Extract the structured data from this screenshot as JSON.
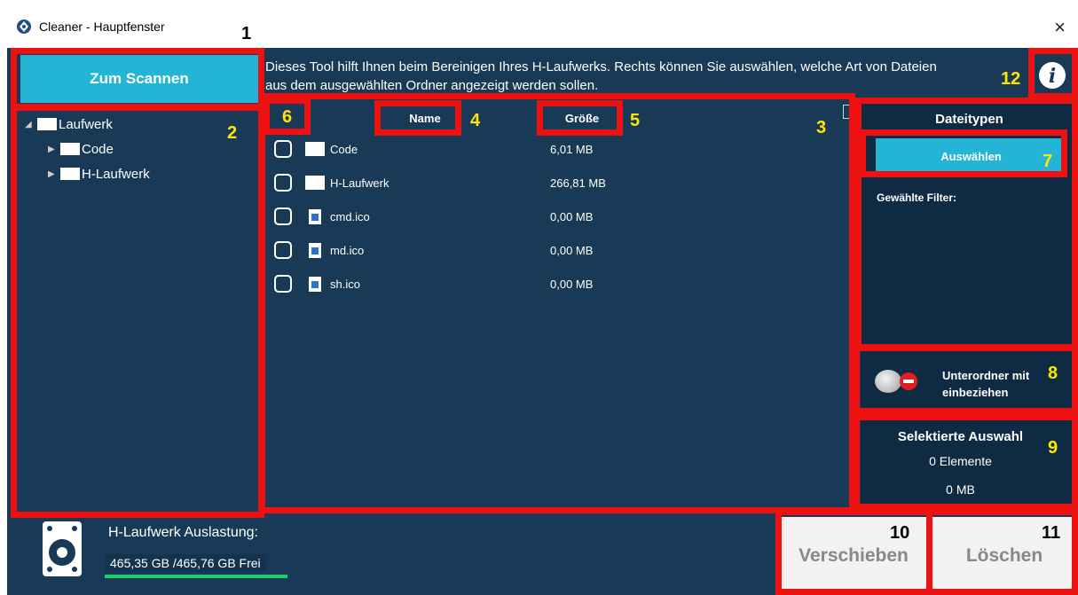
{
  "window": {
    "title": "Cleaner - Hauptfenster",
    "close_glyph": "×"
  },
  "scan_button": {
    "label": "Zum Scannen"
  },
  "info_text": "Dieses Tool hilft Ihnen beim Bereinigen Ihres H-Laufwerks. Rechts können Sie auswählen, welche Art von Dateien aus dem ausgewählten Ordner angezeigt werden sollen.",
  "info_button": {
    "glyph": "i"
  },
  "tree": {
    "root": "Laufwerk",
    "children": [
      "Code",
      "H-Laufwerk"
    ]
  },
  "table": {
    "columns": {
      "name": "Name",
      "size": "Größe"
    },
    "rows": [
      {
        "name": "Code",
        "size": "6,01 MB",
        "kind": "folder"
      },
      {
        "name": "H-Laufwerk",
        "size": "266,81 MB",
        "kind": "folder"
      },
      {
        "name": "cmd.ico",
        "size": "0,00 MB",
        "kind": "file"
      },
      {
        "name": "md.ico",
        "size": "0,00 MB",
        "kind": "file"
      },
      {
        "name": "sh.ico",
        "size": "0,00 MB",
        "kind": "file"
      }
    ]
  },
  "filetypes": {
    "heading": "Dateitypen",
    "select_label": "Auswählen",
    "filter_label": "Gewählte Filter:"
  },
  "subfolders": {
    "label_line1": "Unterordner mit",
    "label_line2": "einbeziehen",
    "enabled": false
  },
  "selection": {
    "title": "Selektierte Auswahl",
    "count": "0 Elemente",
    "size": "0 MB"
  },
  "drive": {
    "label": "H-Laufwerk Auslastung:",
    "free_text": "465,35 GB /465,76 GB Frei",
    "free_fraction": 0.999
  },
  "actions": {
    "move_label": "Verschieben",
    "delete_label": "Löschen"
  },
  "annotations": [
    "1",
    "2",
    "3",
    "4",
    "5",
    "6",
    "7",
    "8",
    "9",
    "10",
    "11",
    "12"
  ],
  "colors": {
    "accent": "#24b5d6",
    "background": "#183a56",
    "panel": "#0f2b43",
    "highlight": "#ee1111",
    "usage": "#1bd06a"
  }
}
